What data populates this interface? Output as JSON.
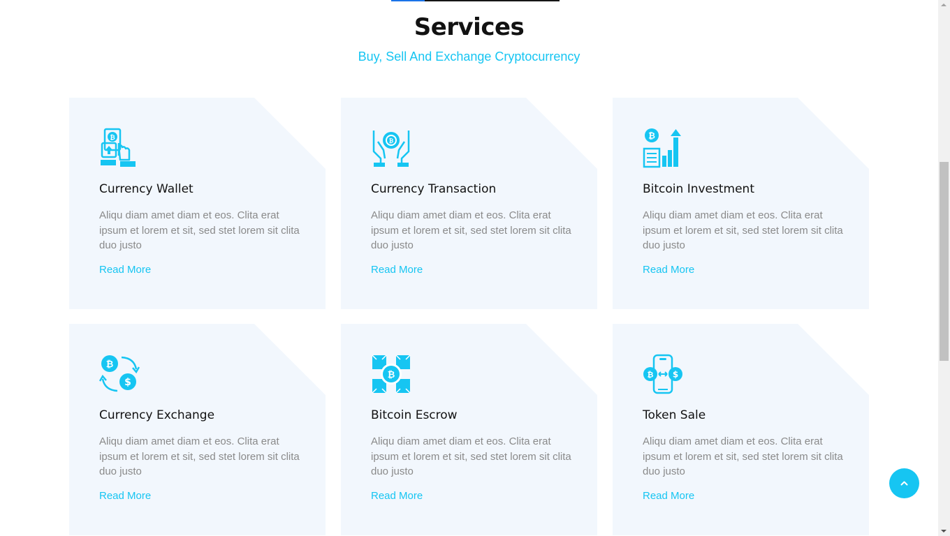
{
  "section": {
    "title": "Services",
    "subtitle": "Buy, Sell And Exchange Cryptocurrency"
  },
  "colors": {
    "accent": "#16c5f2",
    "card_background": "#f2f7fd",
    "title_text": "#121212",
    "body_text": "#8a8a8a"
  },
  "services": [
    {
      "icon": "wallet-icon",
      "title": "Currency Wallet",
      "description": "Aliqu diam amet diam et eos. Clita erat ipsum et lorem et sit, sed stet lorem sit clita duo justo",
      "link_label": "Read More"
    },
    {
      "icon": "transaction-icon",
      "title": "Currency Transaction",
      "description": "Aliqu diam amet diam et eos. Clita erat ipsum et lorem et sit, sed stet lorem sit clita duo justo",
      "link_label": "Read More"
    },
    {
      "icon": "investment-chart-icon",
      "title": "Bitcoin Investment",
      "description": "Aliqu diam amet diam et eos. Clita erat ipsum et lorem et sit, sed stet lorem sit clita duo justo",
      "link_label": "Read More"
    },
    {
      "icon": "exchange-icon",
      "title": "Currency Exchange",
      "description": "Aliqu diam amet diam et eos. Clita erat ipsum et lorem et sit, sed stet lorem sit clita duo justo",
      "link_label": "Read More"
    },
    {
      "icon": "escrow-blocks-icon",
      "title": "Bitcoin Escrow",
      "description": "Aliqu diam amet diam et eos. Clita erat ipsum et lorem et sit, sed stet lorem sit clita duo justo",
      "link_label": "Read More"
    },
    {
      "icon": "token-phone-icon",
      "title": "Token Sale",
      "description": "Aliqu diam amet diam et eos. Clita erat ipsum et lorem et sit, sed stet lorem sit clita duo justo",
      "link_label": "Read More"
    }
  ],
  "back_to_top": {
    "icon": "chevron-up-icon"
  }
}
